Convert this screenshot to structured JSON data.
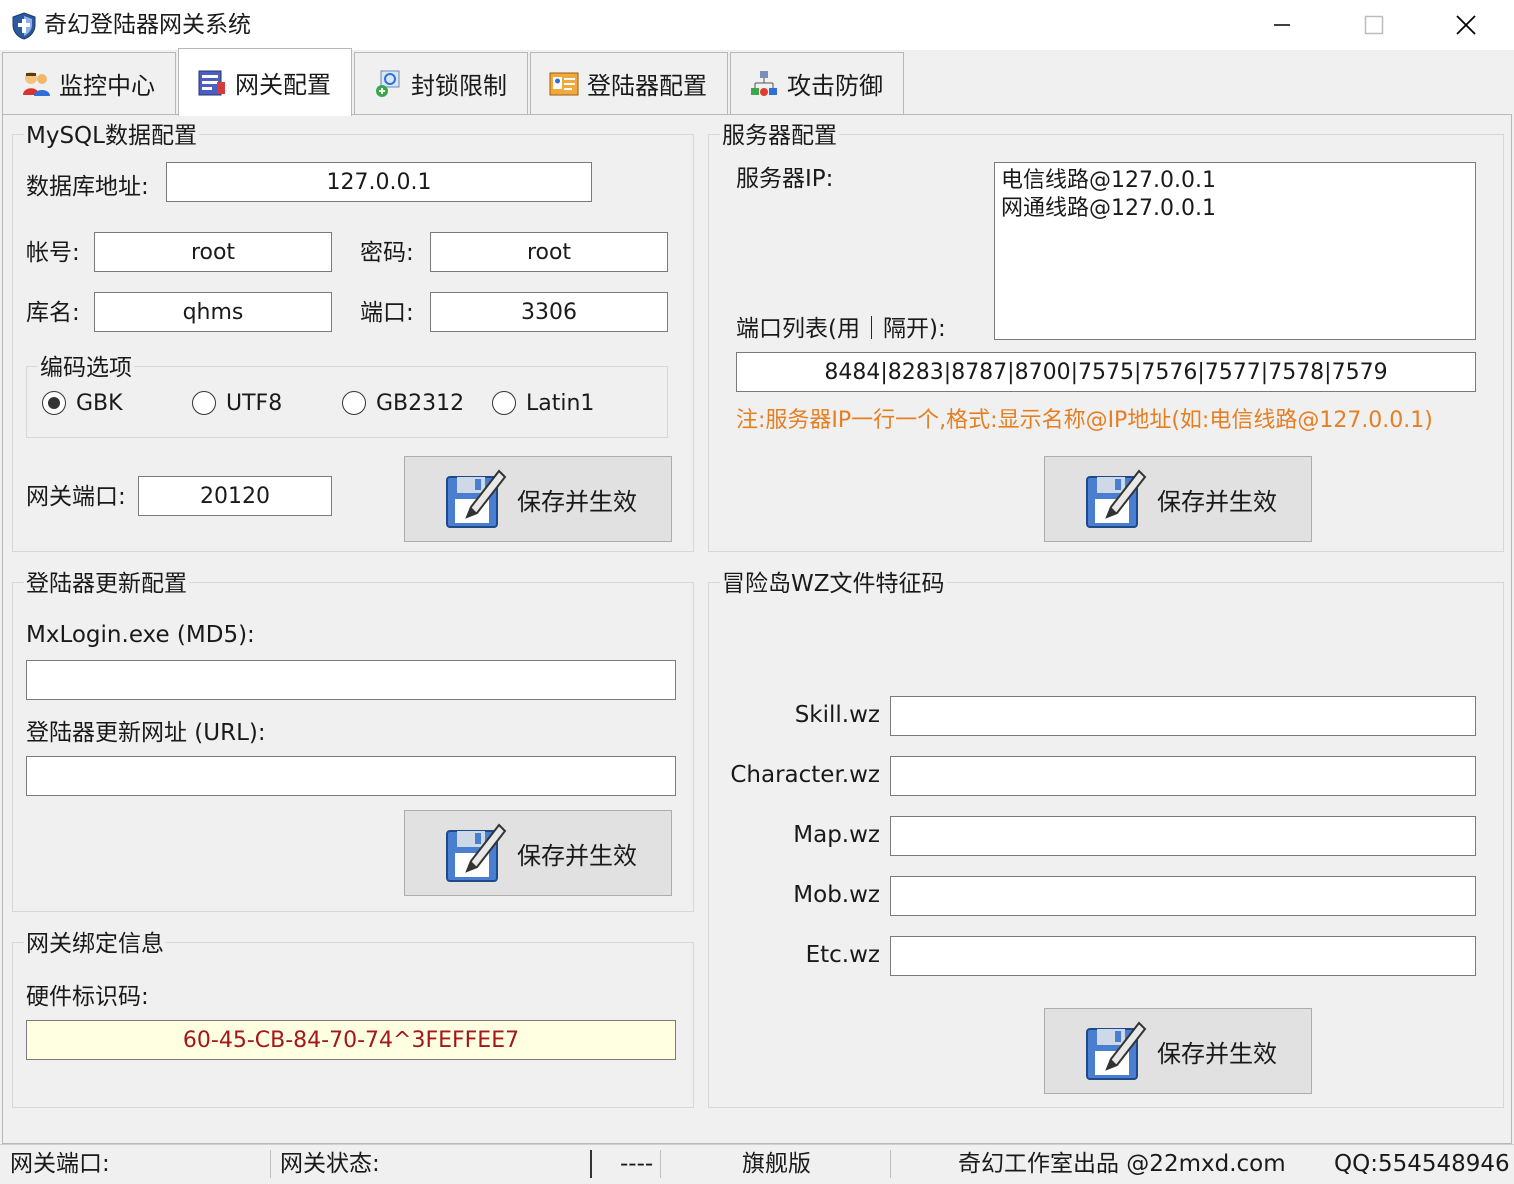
{
  "window": {
    "title": "奇幻登陆器网关系统",
    "icon": "shield-icon",
    "controls": {
      "minimize": "minimize-icon",
      "maximize": "maximize-icon",
      "close": "close-icon"
    }
  },
  "tabs": [
    {
      "label": "监控中心",
      "icon": "users-icon",
      "active": false
    },
    {
      "label": "网关配置",
      "icon": "config-icon",
      "active": true
    },
    {
      "label": "封锁限制",
      "icon": "block-search-icon",
      "active": false
    },
    {
      "label": "登陆器配置",
      "icon": "id-card-icon",
      "active": false
    },
    {
      "label": "攻击防御",
      "icon": "network-defense-icon",
      "active": false
    }
  ],
  "mysql": {
    "legend": "MySQL数据配置",
    "db_address_label": "数据库地址:",
    "db_address": "127.0.0.1",
    "account_label": "帐号:",
    "account": "root",
    "password_label": "密码:",
    "password": "root",
    "dbname_label": "库名:",
    "dbname": "qhms",
    "port_label": "端口:",
    "port": "3306",
    "encoding": {
      "legend": "编码选项",
      "options": [
        "GBK",
        "UTF8",
        "GB2312",
        "Latin1"
      ],
      "selected": "GBK"
    },
    "gateway_port_label": "网关端口:",
    "gateway_port": "20120",
    "save_label": "保存并生效"
  },
  "server": {
    "legend": "服务器配置",
    "ip_label": "服务器IP:",
    "ip_list": "电信线路@127.0.0.1\n网通线路@127.0.0.1",
    "port_list_label": "端口列表(用｜隔开):",
    "port_list": "8484|8283|8787|8700|7575|7576|7577|7578|7579",
    "notice": "注:服务器IP一行一个,格式:显示名称@IP地址(如:电信线路@127.0.0.1)",
    "save_label": "保存并生效"
  },
  "launcher_update": {
    "legend": "登陆器更新配置",
    "md5_label": "MxLogin.exe (MD5):",
    "md5": "",
    "url_label": "登陆器更新网址 (URL):",
    "url": "",
    "save_label": "保存并生效"
  },
  "binding": {
    "legend": "网关绑定信息",
    "hwid_label": "硬件标识码:",
    "hwid": "60-45-CB-84-70-74^3FEFFEE7"
  },
  "wz": {
    "legend": "冒险岛WZ文件特征码",
    "files": [
      {
        "label": "Skill.wz",
        "value": ""
      },
      {
        "label": "Character.wz",
        "value": ""
      },
      {
        "label": "Map.wz",
        "value": ""
      },
      {
        "label": "Mob.wz",
        "value": ""
      },
      {
        "label": "Etc.wz",
        "value": ""
      }
    ],
    "save_label": "保存并生效"
  },
  "statusbar": {
    "gateway_port_label": "网关端口:",
    "gateway_status_label": "网关状态:",
    "dashes": "----",
    "edition": "旗舰版",
    "credit": "奇幻工作室出品 @22mxd.com",
    "qq": "QQ:554548946"
  },
  "colors": {
    "notice": "#e67e22",
    "hwid_text": "#a4161a",
    "hwid_bg": "#ffffe1"
  }
}
